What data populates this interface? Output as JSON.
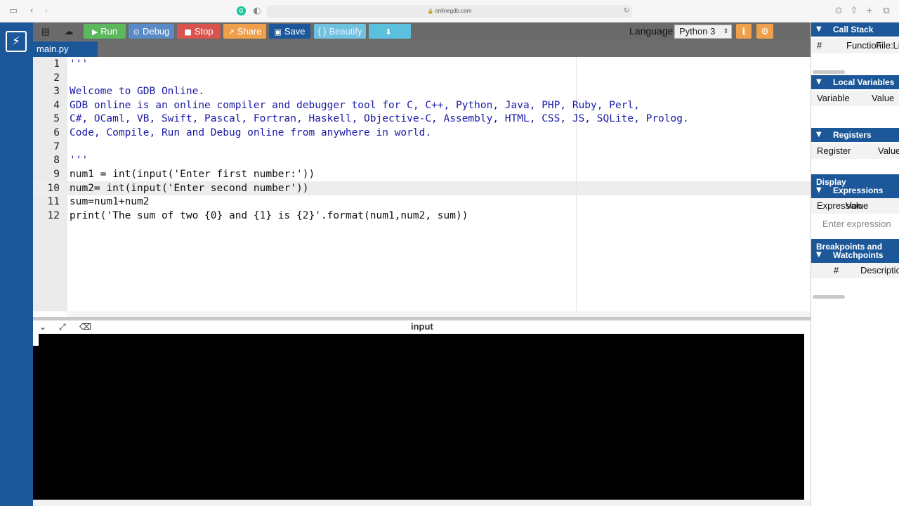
{
  "browser": {
    "url": "onlinegdb.com",
    "icons": [
      "sidebar-icon",
      "back-icon",
      "forward-icon",
      "shield-icon",
      "reload-icon",
      "download-icon",
      "share-icon",
      "new-tab-icon",
      "tabs-icon"
    ]
  },
  "toolbar": {
    "run_label": "Run",
    "debug_label": "Debug",
    "stop_label": "Stop",
    "share_label": "Share",
    "save_label": "Save",
    "beautify_label": "{ } Beautify",
    "language_label": "Language",
    "language_value": "Python 3",
    "colors": {
      "run": "#5cb85c",
      "debug": "#5b8bc7",
      "stop": "#d9534f",
      "share": "#f0a04b",
      "save": "#1c5899",
      "beautify": "#6fc3e0",
      "download": "#5bc0de",
      "settings": "#f0a04b"
    }
  },
  "tab": {
    "filename": "main.py"
  },
  "editor": {
    "active_line": 10,
    "lines": [
      {
        "n": "1",
        "text": "'''"
      },
      {
        "n": "2",
        "text": ""
      },
      {
        "n": "3",
        "text": "Welcome to GDB Online."
      },
      {
        "n": "4",
        "text": "GDB online is an online compiler and debugger tool for C, C++, Python, Java, PHP, Ruby, Perl,"
      },
      {
        "n": "5",
        "text": "C#, OCaml, VB, Swift, Pascal, Fortran, Haskell, Objective-C, Assembly, HTML, CSS, JS, SQLite, Prolog."
      },
      {
        "n": "6",
        "text": "Code, Compile, Run and Debug online from anywhere in world."
      },
      {
        "n": "7",
        "text": ""
      },
      {
        "n": "8",
        "text": "'''"
      },
      {
        "n": "9",
        "text": "num1 = int(input('Enter first number:'))"
      },
      {
        "n": "10",
        "text": "num2= int(input('Enter second number'))"
      },
      {
        "n": "11",
        "text": "sum=num1+num2"
      },
      {
        "n": "12",
        "text": "print('The sum of two {0} and {1} is {2}'.format(num1,num2, sum))"
      }
    ]
  },
  "console": {
    "title": "input"
  },
  "debugger": {
    "call_stack": {
      "title": "Call Stack",
      "cols": [
        "#",
        "Function",
        "File:Li"
      ]
    },
    "local_variables": {
      "title": "Local Variables",
      "cols": [
        "Variable",
        "Value"
      ]
    },
    "registers": {
      "title": "Registers",
      "cols": [
        "Register",
        "Value"
      ]
    },
    "display_expressions": {
      "title_line1": "Display",
      "title_line2": "Expressions",
      "cols": [
        "Expression",
        "Value"
      ],
      "placeholder": "Enter expression"
    },
    "breakpoints": {
      "title_line1": "Breakpoints and",
      "title_line2": "Watchpoints",
      "cols": [
        "#",
        "Description"
      ]
    }
  }
}
